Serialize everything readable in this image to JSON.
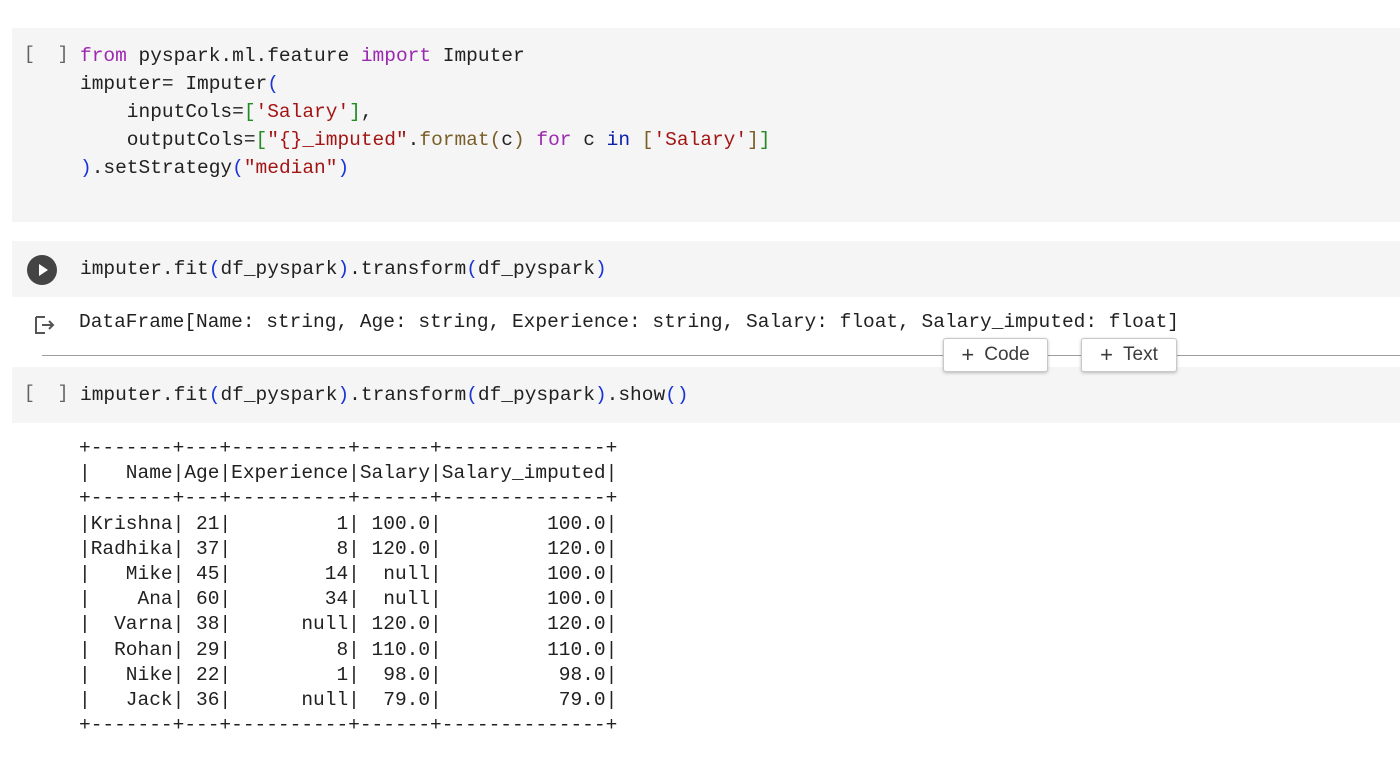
{
  "cells": [
    {
      "id": "cell1",
      "bracket": "[ ]",
      "code_lines": [
        "from pyspark.ml.feature import Imputer",
        "imputer= Imputer(",
        "    inputCols=['Salary'],",
        "    outputCols=[\"{}_imputed\".format(c) for c in ['Salary']]",
        ").setStrategy(\"median\")"
      ]
    },
    {
      "id": "cell2",
      "code": "imputer.fit(df_pyspark).transform(df_pyspark)",
      "output": "DataFrame[Name: string, Age: string, Experience: string, Salary: float, Salary_imputed: float]"
    },
    {
      "id": "cell3",
      "bracket": "[ ]",
      "code": "imputer.fit(df_pyspark).transform(df_pyspark).show()",
      "output_lines": [
        "+-------+---+----------+------+--------------+",
        "|   Name|Age|Experience|Salary|Salary_imputed|",
        "+-------+---+----------+------+--------------+",
        "|Krishna| 21|         1| 100.0|         100.0|",
        "|Radhika| 37|         8| 120.0|         120.0|",
        "|   Mike| 45|        14|  null|         100.0|",
        "|    Ana| 60|        34|  null|         100.0|",
        "|  Varna| 38|      null| 120.0|         120.0|",
        "|  Rohan| 29|         8| 110.0|         110.0|",
        "|   Nike| 22|         1|  98.0|          98.0|",
        "|   Jack| 36|      null|  79.0|          79.0|",
        "+-------+---+----------+------+--------------+"
      ]
    }
  ],
  "toolbar": {
    "add_code_label": "Code",
    "add_text_label": "Text",
    "plus_symbol": "+"
  },
  "icons": {
    "run": "run-cell-icon",
    "output": "output-arrow-icon"
  },
  "colors": {
    "keyword": "#9c27b0",
    "keyword_blue": "#0d22aa",
    "string": "#a31515",
    "cell_background": "#f5f5f5"
  }
}
